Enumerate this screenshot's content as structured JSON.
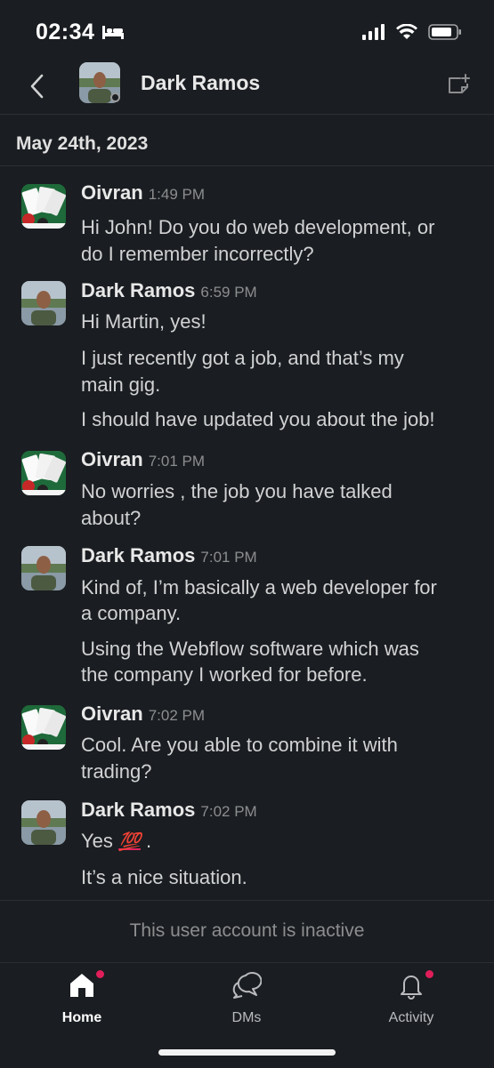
{
  "status_bar": {
    "time": "02:34"
  },
  "header": {
    "name": "Dark Ramos"
  },
  "date_divider": "May 24th, 2023",
  "messages": [
    {
      "author": "Oivran",
      "time": "1:49 PM",
      "avatar": "poker-cards-avatar",
      "lines": [
        "Hi John! Do you do web development, or",
        "do I remember incorrectly?"
      ]
    },
    {
      "author": "Dark Ramos",
      "time": "6:59 PM",
      "avatar": "person-photo-avatar",
      "lines": [
        "Hi Martin, yes!",
        "I just recently got a job, and that’s my",
        "main gig.",
        "I should have updated you about the job!"
      ]
    },
    {
      "author": "Oivran",
      "time": "7:01 PM",
      "avatar": "poker-cards-avatar",
      "lines": [
        "No worries , the job you have talked",
        "about?"
      ]
    },
    {
      "author": "Dark Ramos",
      "time": "7:01 PM",
      "avatar": "person-photo-avatar",
      "lines": [
        "Kind of, I’m basically a web developer for",
        "a company.",
        "Using the Webflow software which was",
        "the company I worked for before."
      ]
    },
    {
      "author": "Oivran",
      "time": "7:02 PM",
      "avatar": "poker-cards-avatar",
      "lines": [
        "Cool. Are you able to combine it with",
        "trading?"
      ]
    },
    {
      "author": "Dark Ramos",
      "time": "7:02 PM",
      "avatar": "person-photo-avatar",
      "lines": [
        "Yes",
        "💯",
        ".",
        "It’s a nice situation."
      ]
    }
  ],
  "inactive_notice": "This user account is inactive",
  "tabs": [
    {
      "label": "Home",
      "icon": "home-icon",
      "active": true,
      "badge": true
    },
    {
      "label": "DMs",
      "icon": "dms-icon",
      "active": false,
      "badge": false
    },
    {
      "label": "Activity",
      "icon": "bell-icon",
      "active": false,
      "badge": true
    }
  ],
  "colors": {
    "background": "#1a1d21",
    "badge": "#e01e5a",
    "text": "#d1d2d3"
  }
}
